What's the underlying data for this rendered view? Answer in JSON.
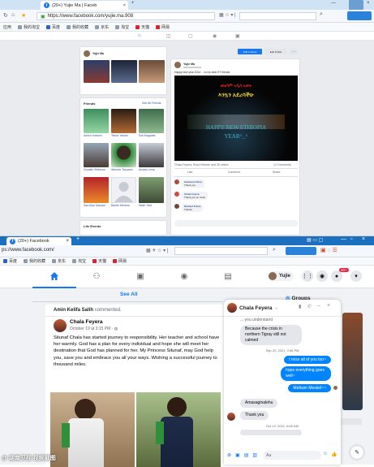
{
  "top_window": {
    "tab_title": "(20+) Yujie Ma | Faceb",
    "url": "https://www.facebook.com/yujie.ma.908",
    "bookmarks": [
      "应用",
      "我的淘宝",
      "百度",
      "我的收藏",
      "京东",
      "淘宝",
      "天猫",
      "网易"
    ],
    "profile": {
      "name_short": "Yujie Ma",
      "edit_profile": "Edit Profile",
      "add_story": "Add to Story"
    },
    "friends": {
      "title": "Friends",
      "see_all": "See All Friends",
      "names": [
        "Amha Hussein",
        "Tsedu Yasine",
        "Soli Maganta",
        "Zeyakin Shiferaw",
        "Werede Teepane",
        "Andalo Lena",
        "Saa Alan Macavo",
        "Bantie Mersha",
        "Natib Yiba"
      ]
    },
    "life_events": "Life Events",
    "post": {
      "author": "Yujie Ma",
      "text": "Happy new year 2014 ... to my dear ET friends",
      "greeting_amharic_1": "መልካም አዲስ አመት",
      "greeting_amharic_2": "እንኳን አደረሳችሁ",
      "greeting_en_1": "HAPPY NEW ETHIOPIA",
      "greeting_en_2": "YEAR^_^",
      "reactions": "Chala Feyera, Roza Kebede and 35 others",
      "comments_count": "12 Comments",
      "like": "Like",
      "comment": "Comment",
      "share": "Share",
      "comments": [
        {
          "name": "Haimanot Fikru",
          "text": "Thank you"
        },
        {
          "name": "Chala Feyera",
          "text": "Thank you so much"
        },
        {
          "name": "Natnael Tefere",
          "text": "Thanks"
        }
      ]
    }
  },
  "bottom_window": {
    "tab_title": "(20+) Facebook",
    "url": "ps://www.facebook.com/",
    "bookmarks": [
      "百度",
      "我的收藏",
      "京东",
      "淘宝",
      "天猫",
      "网易"
    ],
    "user_name": "Yujie",
    "notif_count": "20+",
    "see_all": "See All",
    "feed": {
      "activity": "Amin Kelifa Salih commented.",
      "activity_name": "Amin Kelifa Salih",
      "activity_verb": "commented.",
      "author": "Chala Feyera",
      "date": "October 19 at 3:15 PM · ",
      "body": "Situnaf Chala has started journey to responsibility. Her teacher and school have her warmly. God has a plan for every individual and hope she will meet her destination that God has planned for her. My Princess Situnaf, may God help you, save you and embrace you all your ways. Wishing a successful journey to thousand miles."
    },
    "chat": {
      "name": "Chala Feyera",
      "top_partial": "... you understand",
      "messages": [
        {
          "side": "left",
          "text": "Because the crisis in northern Tigray still not calmed"
        },
        {
          "side": "time",
          "text": "Sep 22, 2021, 3:46 PM"
        },
        {
          "side": "right",
          "text": "I miss all of you too~"
        },
        {
          "side": "right",
          "text": "hope everything goes well~"
        },
        {
          "side": "right",
          "text": "Melkam Meskel~~"
        },
        {
          "side": "left",
          "text": "Amasaginalehu"
        },
        {
          "side": "left",
          "text": "Thank you"
        },
        {
          "side": "time",
          "text": "Oct 12, 2021, 8:00 AM"
        }
      ],
      "input_placeholder": "Aa"
    },
    "groups": "Groups",
    "watermark": "@ 湖南卫视 视频截图"
  }
}
